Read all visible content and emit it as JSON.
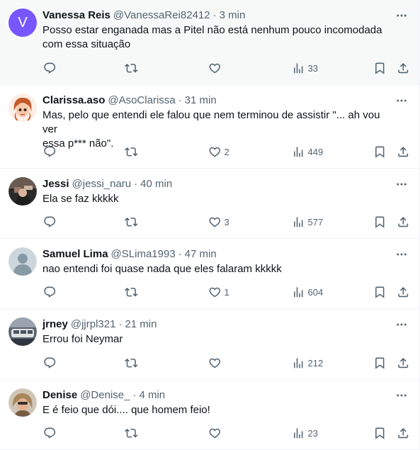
{
  "colors": {
    "accent": "#7856ff",
    "muted": "#536471",
    "text": "#0f1419",
    "divider": "#eff3f4"
  },
  "icons": [
    "reply-icon",
    "retweet-icon",
    "like-icon",
    "views-icon",
    "bookmark-icon",
    "share-icon",
    "more-icon"
  ],
  "tweets": [
    {
      "name": "Vanessa Reis",
      "handle": "@VanessaRei82412",
      "dot": "·",
      "time": "3 min",
      "avatar_letter": "V",
      "text": "Posso estar enganada mas a Pitel não está nenhum pouco incomodada\ncom essa situação",
      "replies": "",
      "retweets": "",
      "likes": "",
      "views": "33"
    },
    {
      "name": "Clarissa.aso",
      "handle": "@AsoClarissa",
      "dot": "·",
      "time": "31 min",
      "text": "Mas, pelo que entendi ele falou que nem terminou de assistir \"... ah vou ver\nessa p*** não\".",
      "replies": "",
      "retweets": "",
      "likes": "2",
      "views": "449"
    },
    {
      "name": "Jessi",
      "handle": "@jessi_naru",
      "dot": "·",
      "time": "40 min",
      "text": "Ela se faz kkkkk",
      "replies": "",
      "retweets": "",
      "likes": "3",
      "views": "577"
    },
    {
      "name": "Samuel Lima",
      "handle": "@SLima1993",
      "dot": "·",
      "time": "47 min",
      "text": "nao entendi foi quase nada que eles falaram kkkkk",
      "replies": "",
      "retweets": "",
      "likes": "1",
      "views": "604"
    },
    {
      "name": "jrney",
      "handle": "@jjrpl321",
      "dot": "·",
      "time": "21 min",
      "text": "Errou foi Neymar",
      "replies": "",
      "retweets": "",
      "likes": "",
      "views": "212"
    },
    {
      "name": "Denise",
      "handle": "@Denise_",
      "dot": "·",
      "time": "4 min",
      "text": "E é feio que dói.... que homem feio!",
      "replies": "",
      "retweets": "",
      "likes": "",
      "views": "23"
    }
  ]
}
